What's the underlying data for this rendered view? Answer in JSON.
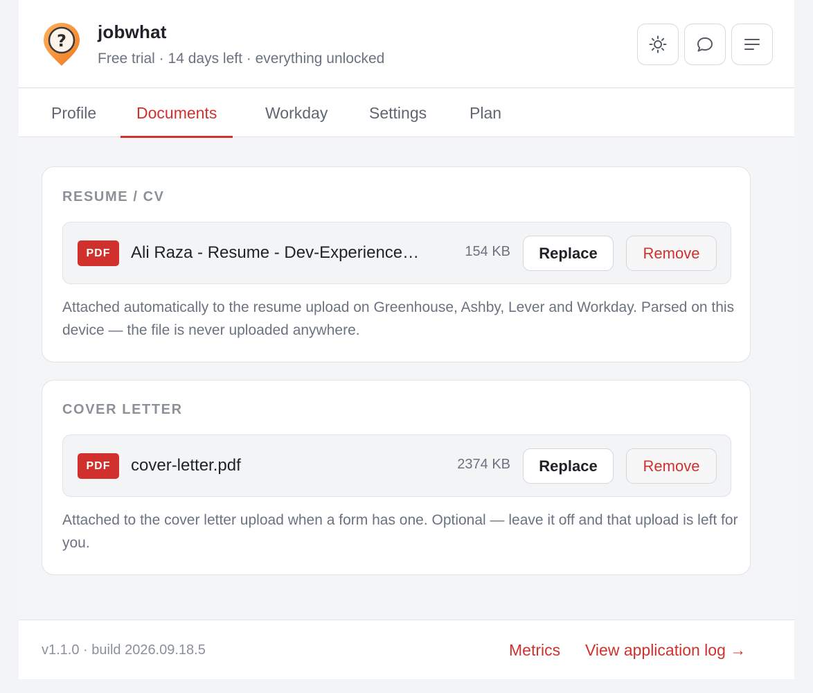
{
  "app": {
    "name": "jobwhat",
    "subtitle": "Free trial · 14 days left · everything unlocked",
    "logo_glyph": "?"
  },
  "header_buttons": [
    {
      "icon": "sun-icon"
    },
    {
      "icon": "chat-bubble-icon"
    },
    {
      "icon": "menu-lines-icon"
    }
  ],
  "tabs": [
    {
      "label": "Profile"
    },
    {
      "label": "Documents",
      "active": true
    },
    {
      "label": "Workday"
    },
    {
      "label": "Settings"
    },
    {
      "label": "Plan"
    }
  ],
  "resume": {
    "section_title": "RESUME / CV",
    "badge": "PDF",
    "file_name": "Ali Raza - Resume - Dev-Experience…",
    "file_size": "154 KB",
    "replace_label": "Replace",
    "remove_label": "Remove",
    "note": "Attached automatically to the resume upload on Greenhouse, Ashby, Lever and Workday. Parsed on this device — the file is never uploaded anywhere."
  },
  "cover_letter": {
    "section_title": "COVER LETTER",
    "badge": "PDF",
    "file_name": "cover-letter.pdf",
    "file_size": "2374 KB",
    "replace_label": "Replace",
    "remove_label": "Remove",
    "note": "Attached to the cover letter upload when a form has one. Optional — leave it off and that upload is left for you."
  },
  "footer": {
    "version": "v1.1.0 · build 2026.09.18.5",
    "metrics_label": "Metrics",
    "log_label": "View application log →"
  },
  "colors": {
    "accent": "#d0312d",
    "logo_orange": "#f28a2e"
  }
}
